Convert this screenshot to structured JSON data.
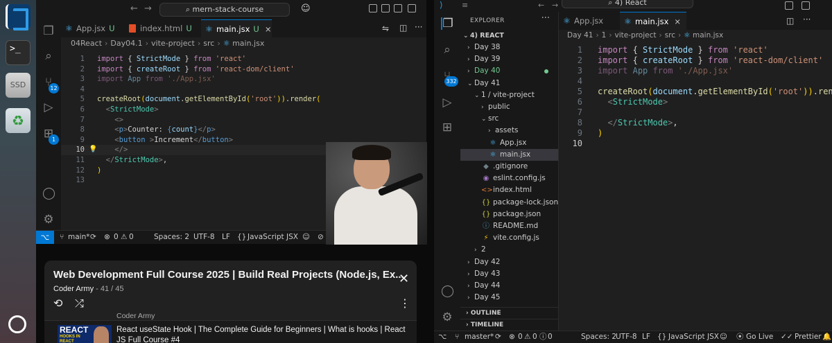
{
  "dock": {
    "terminal_glyph": ">_",
    "ssd_label": "SSD",
    "trash_glyph": "♻"
  },
  "left": {
    "search": "mern-stack-course",
    "tabs": [
      {
        "label": "App.jsx",
        "status": "U"
      },
      {
        "label": "index.html",
        "status": "U"
      },
      {
        "label": "main.jsx",
        "status": "U",
        "close": "×"
      }
    ],
    "breadcrumb": [
      "04React",
      "Day04.1",
      "vite-project",
      "src",
      "main.jsx"
    ],
    "scm_badge": "12",
    "account_badge": "1",
    "code": [
      {
        "n": "1",
        "html": "<span class='k'>import</span> <span class='w'>{ </span><span class='v'>StrictMode</span><span class='w'> } </span><span class='k'>from</span> <span class='s'>'react'</span>"
      },
      {
        "n": "2",
        "html": "<span class='k'>import</span> <span class='w'>{ </span><span class='v'>createRoot</span><span class='w'> } </span><span class='k'>from</span> <span class='s'>'react-dom/client'</span>"
      },
      {
        "n": "3",
        "html": "<span class='dim'><span class='k'>import</span> <span class='v'>App</span> <span class='k'>from</span> <span class='s'>'./App.jsx'</span></span>"
      },
      {
        "n": "4",
        "html": ""
      },
      {
        "n": "5",
        "html": "<span class='f'>createRoot</span><span class='p'>(</span><span class='v'>document</span><span class='w'>.</span><span class='f'>getElementById</span><span class='p'>(</span><span class='s'>'root'</span><span class='p'>)</span><span class='p'>)</span><span class='w'>.</span><span class='f'>render</span><span class='p'>(</span>"
      },
      {
        "n": "6",
        "html": "  <span class='g'>&lt;</span><span class='t'>StrictMode</span><span class='g'>&gt;</span>"
      },
      {
        "n": "7",
        "html": "    <span class='g'>&lt;&gt;</span>"
      },
      {
        "n": "8",
        "html": "    <span class='g'>&lt;</span><span class='d'>p</span><span class='g'>&gt;</span><span class='w'>Counter: </span><span class='d'>{</span><span class='v'>count</span><span class='d'>}</span><span class='g'>&lt;/</span><span class='d'>p</span><span class='g'>&gt;</span>"
      },
      {
        "n": "9",
        "html": "    <span class='g'>&lt;</span><span class='d'>button</span> <span class='g'>&gt;</span><span class='w'>Increment</span><span class='g'>&lt;/</span><span class='d'>button</span><span class='g'>&gt;</span>"
      },
      {
        "n": "10",
        "html": "    <span class='g'>&lt;/&gt;</span>"
      },
      {
        "n": "11",
        "html": "  <span class='g'>&lt;/</span><span class='t'>StrictMode</span><span class='g'>&gt;</span><span class='w'>,</span>"
      },
      {
        "n": "12",
        "html": "<span class='p'>)</span>"
      },
      {
        "n": "13",
        "html": ""
      }
    ],
    "status": {
      "branch": "main*",
      "problems": "0",
      "warnings": "0",
      "spaces": "Spaces: 2",
      "encoding": "UTF-8",
      "eol": "LF",
      "language": "JavaScript JSX"
    }
  },
  "youtube": {
    "title": "Web Development Full Course 2025 | Build Real Projects (Node.js, Ex...",
    "channel": "Coder Army",
    "position": "41 / 45",
    "prev_channel": "Coder Army",
    "next_video": "React useState Hook | The Complete Guide for Beginners | What is hooks | React JS Full Course #4",
    "thumb_text": "REACT",
    "thumb_sub": "HOOKS IN REACT USESTATE HOOK"
  },
  "right": {
    "search": "4) React",
    "explorer_label": "EXPLORER",
    "workspace": "4) REACT",
    "scm_badge": "332",
    "tabs": [
      {
        "label": "App.jsx"
      },
      {
        "label": "main.jsx",
        "close": "×"
      }
    ],
    "breadcrumb": [
      "Day 41",
      "1",
      "vite-project",
      "src",
      "main.jsx"
    ],
    "tree": [
      {
        "label": "Day 38",
        "depth": 0,
        "chev": "›"
      },
      {
        "label": "Day 39",
        "depth": 0,
        "chev": "›"
      },
      {
        "label": "Day 40",
        "depth": 0,
        "chev": "›",
        "green": true,
        "dot": true
      },
      {
        "label": "Day 41",
        "depth": 0,
        "chev": "⌄"
      },
      {
        "label": "1 / vite-project",
        "depth": 1,
        "chev": "⌄"
      },
      {
        "label": "public",
        "depth": 2,
        "chev": "›"
      },
      {
        "label": "src",
        "depth": 2,
        "chev": "⌄"
      },
      {
        "label": "assets",
        "depth": 3,
        "chev": "›"
      },
      {
        "label": "App.jsx",
        "depth": 3,
        "icon": "⚛"
      },
      {
        "label": "main.jsx",
        "depth": 3,
        "icon": "⚛",
        "sel": true
      },
      {
        "label": ".gitignore",
        "depth": 2,
        "icon": "◆"
      },
      {
        "label": "eslint.config.js",
        "depth": 2,
        "icon": "◉"
      },
      {
        "label": "index.html",
        "depth": 2,
        "icon": "<>"
      },
      {
        "label": "package-lock.json",
        "depth": 2,
        "icon": "{}"
      },
      {
        "label": "package.json",
        "depth": 2,
        "icon": "{}"
      },
      {
        "label": "README.md",
        "depth": 2,
        "icon": "ⓘ"
      },
      {
        "label": "vite.config.js",
        "depth": 2,
        "icon": "⚡"
      },
      {
        "label": "2",
        "depth": 1,
        "chev": "›"
      },
      {
        "label": "Day 42",
        "depth": 0,
        "chev": "›"
      },
      {
        "label": "Day 43",
        "depth": 0,
        "chev": "›"
      },
      {
        "label": "Day 44",
        "depth": 0,
        "chev": "›"
      },
      {
        "label": "Day 45",
        "depth": 0,
        "chev": "›"
      }
    ],
    "outline_label": "OUTLINE",
    "timeline_label": "TIMELINE",
    "code": [
      {
        "n": "1",
        "html": "<span class='k'>import</span> <span class='w'>{ </span><span class='v'>StrictMode</span><span class='w'> } </span><span class='k'>from</span> <span class='s'>'react'</span>"
      },
      {
        "n": "2",
        "html": "<span class='k'>import</span> <span class='w'>{ </span><span class='v'>createRoot</span><span class='w'> } </span><span class='k'>from</span> <span class='s'>'react-dom/client'</span>"
      },
      {
        "n": "3",
        "html": "<span class='dim'><span class='k'>import</span> <span class='v'>App</span> <span class='k'>from</span> <span class='s'>'./App.jsx'</span></span>"
      },
      {
        "n": "4",
        "html": ""
      },
      {
        "n": "5",
        "html": "<span class='f'>createRoot</span><span class='p'>(</span><span class='v'>document</span><span class='w'>.</span><span class='f'>getElementById</span><span class='p'>(</span><span class='s'>'root'</span><span class='p'>)</span><span class='p'>)</span><span class='w'>.</span><span class='f'>render</span><span class='p'>(</span>"
      },
      {
        "n": "6",
        "html": "  <span class='g'>&lt;</span><span class='t'>StrictMode</span><span class='g'>&gt;</span>"
      },
      {
        "n": "7",
        "html": ""
      },
      {
        "n": "8",
        "html": "  <span class='g'>&lt;/</span><span class='t'>StrictMode</span><span class='g'>&gt;</span><span class='w'>,</span>"
      },
      {
        "n": "9",
        "html": "<span class='p'>)</span>"
      },
      {
        "n": "10",
        "html": ""
      }
    ],
    "status": {
      "branch": "master*",
      "problems": "0",
      "warnings": "0",
      "info": "0",
      "spaces": "Spaces: 2",
      "encoding": "UTF-8",
      "eol": "LF",
      "language": "JavaScript JSX",
      "golive": "Go Live",
      "prettier": "Prettier"
    }
  }
}
